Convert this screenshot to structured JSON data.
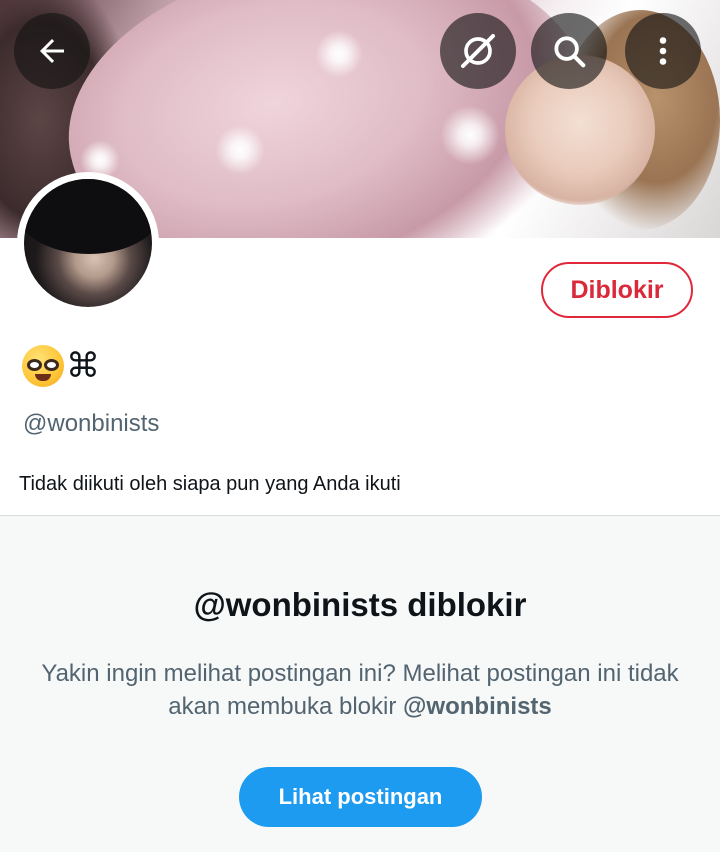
{
  "profile": {
    "display_name_symbol": "⌘",
    "display_name_emoji": "nerd-face",
    "handle": "@wonbinists",
    "follow_context": "Tidak diikuti oleh siapa pun yang Anda ikuti",
    "block_button_label": "Diblokir"
  },
  "header_actions": {
    "back_icon": "back-arrow-icon",
    "grok_icon": "grok-icon",
    "search_icon": "search-icon",
    "more_icon": "more-vertical-icon"
  },
  "blocked_notice": {
    "title": "@wonbinists diblokir",
    "message_part1": "Yakin ingin melihat postingan ini? Melihat postingan ini tidak akan membuka blokir ",
    "message_handle": "@wonbinists",
    "view_button_label": "Lihat postingan"
  },
  "colors": {
    "blocked_red": "#d9293a",
    "primary_blue": "#1d9bf0",
    "secondary_text": "#536471",
    "panel_bg": "#f7f9f9"
  }
}
